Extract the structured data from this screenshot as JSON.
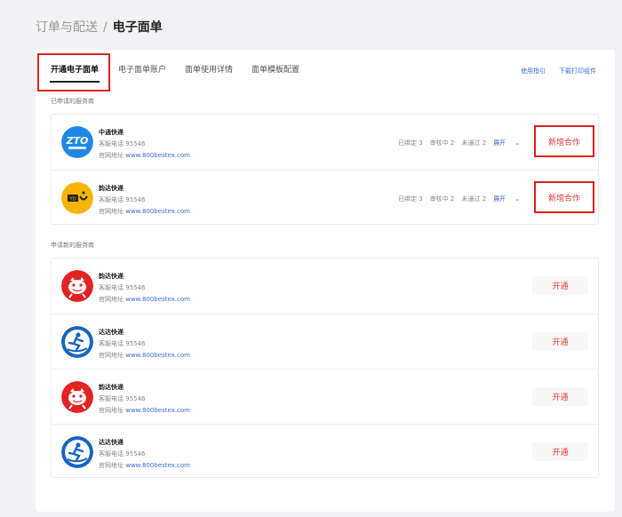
{
  "breadcrumb": {
    "parent": "订单与配送",
    "separator": "/",
    "current": "电子面单"
  },
  "tabs": [
    {
      "label": "开通电子面单",
      "active": true
    },
    {
      "label": "电子面单账户",
      "active": false
    },
    {
      "label": "面单使用详情",
      "active": false
    },
    {
      "label": "面单模板配置",
      "active": false
    }
  ],
  "top_links": {
    "guide": "使用指引",
    "download": "下载打印组件"
  },
  "applied_section": {
    "title": "已申请的服务商",
    "providers": [
      {
        "name": "中通快递",
        "logo_icon": "zto-logo-icon",
        "phone_label": "客服电话",
        "phone": "95546",
        "site_label": "官网地址",
        "site": "www.800bestex.com",
        "stats": {
          "bound": "已绑定 3",
          "reviewing": "审核中 2",
          "rejected": "未通过 2",
          "expand": "展开"
        },
        "action": "新增合作"
      },
      {
        "name": "韵达快递",
        "logo_icon": "yunda-logo-icon",
        "phone_label": "客服电话",
        "phone": "95546",
        "site_label": "官网地址",
        "site": "www.800bestex.com",
        "stats": {
          "bound": "已绑定 3",
          "reviewing": "审核中 2",
          "rejected": "未通过 2",
          "expand": "展开"
        },
        "action": "新增合作"
      }
    ]
  },
  "new_section": {
    "title": "申请新的服务商",
    "providers": [
      {
        "name": "韵达快递",
        "logo_icon": "jd-logo-icon",
        "phone_label": "客服电话",
        "phone": "95546",
        "site_label": "官网地址",
        "site": "www.800bestex.com",
        "action": "开通"
      },
      {
        "name": "达达快递",
        "logo_icon": "dada-logo-icon",
        "phone_label": "客服电话",
        "phone": "95546",
        "site_label": "官网地址",
        "site": "www.800bestex.com",
        "action": "开通"
      },
      {
        "name": "韵达快递",
        "logo_icon": "jd-logo-icon",
        "phone_label": "客服电话",
        "phone": "95546",
        "site_label": "官网地址",
        "site": "www.800bestex.com",
        "action": "开通"
      },
      {
        "name": "达达快递",
        "logo_icon": "dada-logo-icon",
        "phone_label": "客服电话",
        "phone": "95546",
        "site_label": "官网地址",
        "site": "www.800bestex.com",
        "action": "开通"
      }
    ]
  },
  "colors": {
    "accent_red": "#e53935",
    "link_blue": "#3b6fd8",
    "zto_blue": "#1e88e5",
    "yunda_yellow": "#f5b400",
    "jd_red": "#e32222",
    "dada_blue": "#1565c0"
  }
}
